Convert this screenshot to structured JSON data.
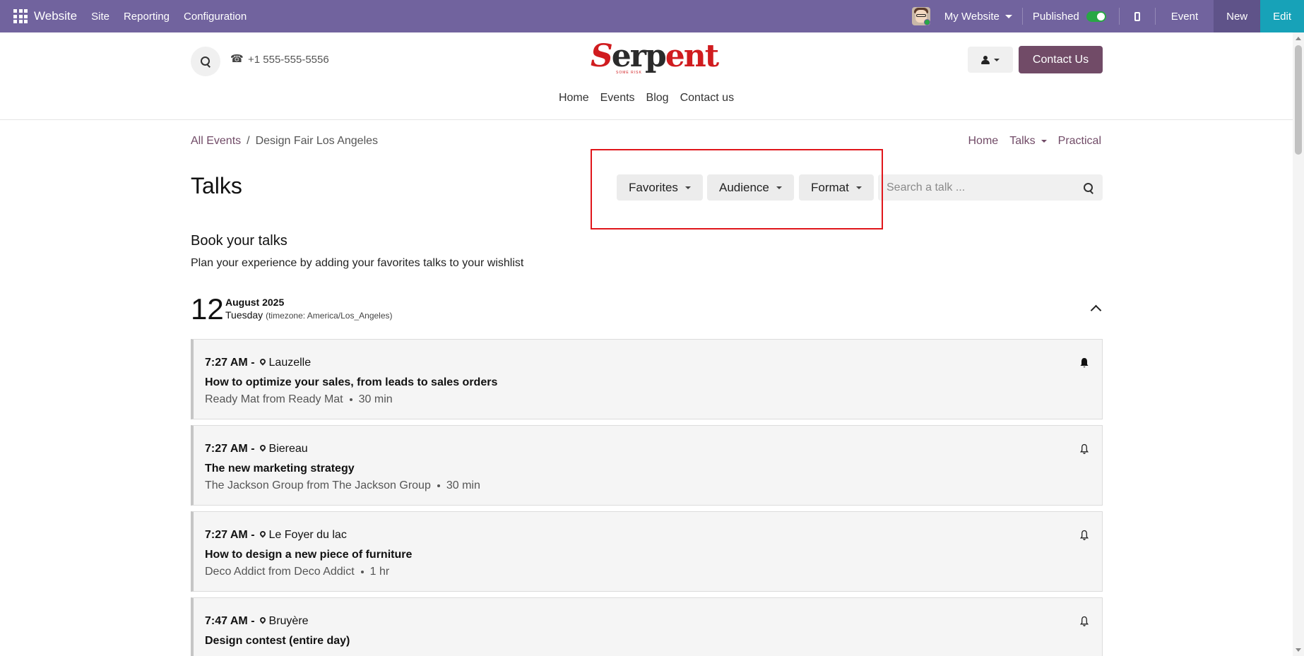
{
  "topbar": {
    "brand": "Website",
    "menu": [
      "Site",
      "Reporting",
      "Configuration"
    ],
    "website_selector": "My Website",
    "published_label": "Published",
    "event_label": "Event",
    "new_label": "New",
    "edit_label": "Edit",
    "colors": {
      "bar": "#71639e",
      "new": "#5f5389",
      "edit": "#17a2b8",
      "toggle_on": "#28a745"
    }
  },
  "header": {
    "phone": "+1 555-555-5556",
    "logo": {
      "s": "S",
      "erp": "erp",
      "ent": "ent",
      "tagline": "SOME RISK"
    },
    "contact_button": "Contact Us",
    "nav": [
      "Home",
      "Events",
      "Blog",
      "Contact us"
    ],
    "colors": {
      "brand": "#714b67",
      "logo_red": "#d01c1f"
    }
  },
  "breadcrumb": {
    "root": "All Events",
    "separator": "/",
    "current": "Design Fair Los Angeles"
  },
  "subnav": [
    "Home",
    "Talks",
    "Practical"
  ],
  "page": {
    "title": "Talks",
    "filters": [
      "Favorites",
      "Audience",
      "Format"
    ],
    "search_placeholder": "Search a talk ..."
  },
  "book": {
    "heading": "Book your talks",
    "subheading": "Plan your experience by adding your favorites talks to your wishlist"
  },
  "day": {
    "number": "12",
    "month_year": "August 2025",
    "weekday": "Tuesday",
    "timezone": "(timezone: America/Los_Angeles)"
  },
  "talks": [
    {
      "time": "7:27 AM -",
      "location": "Lauzelle",
      "name": "How to optimize your sales, from leads to sales orders",
      "speaker": "Ready Mat from Ready Mat",
      "duration": "30 min",
      "reminder": "bell-filled-icon"
    },
    {
      "time": "7:27 AM -",
      "location": "Biereau",
      "name": "The new marketing strategy",
      "speaker": "The Jackson Group from The Jackson Group",
      "duration": "30 min",
      "reminder": "bell-outline-icon"
    },
    {
      "time": "7:27 AM -",
      "location": "Le Foyer du lac",
      "name": "How to design a new piece of furniture",
      "speaker": "Deco Addict from Deco Addict",
      "duration": "1 hr",
      "reminder": "bell-outline-icon"
    },
    {
      "time": "7:47 AM -",
      "location": "Bruyère",
      "name": "Design contest (entire day)",
      "speaker": "",
      "duration": "",
      "reminder": "bell-outline-icon"
    }
  ]
}
